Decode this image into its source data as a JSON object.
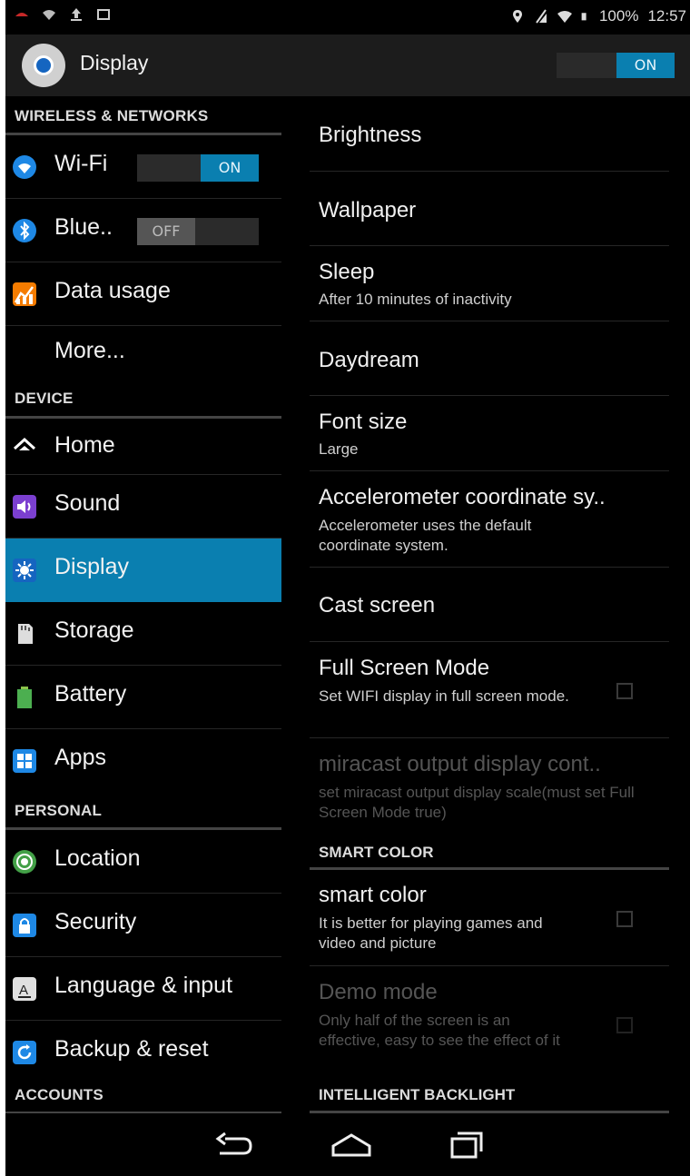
{
  "status": {
    "battery": "100%",
    "time": "12:57"
  },
  "header": {
    "title": "Display",
    "toggle": "ON"
  },
  "left": {
    "sections": {
      "wireless": "WIRELESS & NETWORKS",
      "device": "DEVICE",
      "personal": "PERSONAL",
      "accounts": "ACCOUNTS"
    },
    "items": {
      "wifi": {
        "label": "Wi-Fi",
        "toggle": "ON"
      },
      "bluetooth": {
        "label": "Blue..",
        "toggle": "OFF"
      },
      "data": "Data usage",
      "more": "More...",
      "home": "Home",
      "sound": "Sound",
      "display": "Display",
      "storage": "Storage",
      "battery": "Battery",
      "apps": "Apps",
      "location": "Location",
      "security": "Security",
      "language": "Language & input",
      "backup": "Backup & reset"
    }
  },
  "right": {
    "brightness": "Brightness",
    "wallpaper": "Wallpaper",
    "sleep": {
      "title": "Sleep",
      "summary": "After 10 minutes of inactivity"
    },
    "daydream": "Daydream",
    "fontsize": {
      "title": "Font size",
      "summary": "Large"
    },
    "accel": {
      "title": "Accelerometer coordinate sy..",
      "summary": "Accelerometer uses the default coordinate system."
    },
    "cast": "Cast screen",
    "fullscreen": {
      "title": "Full Screen Mode",
      "summary": "Set WIFI display in full screen mode."
    },
    "miracast": {
      "title": "miracast output display cont..",
      "summary": "set miracast output display scale(must set Full Screen Mode true)"
    },
    "smart_header": "SMART COLOR",
    "smartcolor": {
      "title": "smart color",
      "summary": "It is better for playing games and video and picture"
    },
    "demo": {
      "title": "Demo mode",
      "summary": "Only half of the screen is an effective, easy to see the effect of it"
    },
    "backlight_header": "INTELLIGENT BACKLIGHT"
  }
}
